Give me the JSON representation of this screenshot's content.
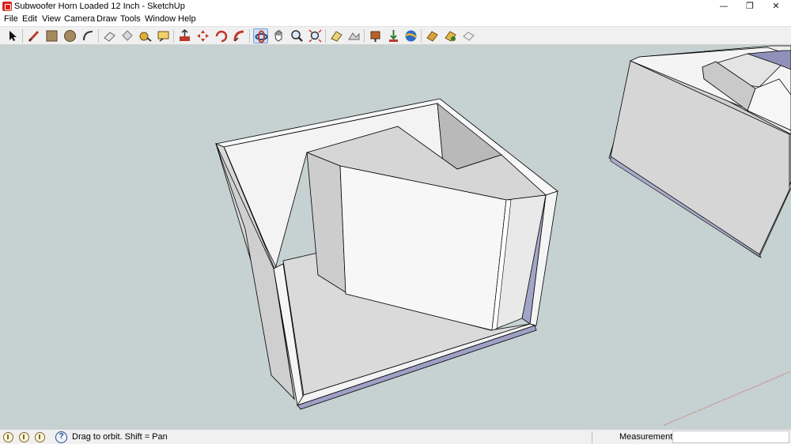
{
  "window": {
    "title": "Subwoofer Horn Loaded 12 Inch - SketchUp",
    "controls": {
      "minimize": "—",
      "restore": "❐",
      "close": "✕"
    }
  },
  "menu": [
    "File",
    "Edit",
    "View",
    "Camera",
    "Draw",
    "Tools",
    "Window",
    "Help"
  ],
  "toolbar": {
    "tools": [
      "select-icon",
      "line-icon",
      "rectangle-icon",
      "circle-icon",
      "arc-icon",
      "eraser-icon",
      "paint-bucket-icon",
      "tape-measure-icon",
      "text-label-icon",
      "push-pull-icon",
      "move-icon",
      "rotate-icon",
      "follow-me-icon",
      "orbit-icon",
      "pan-icon",
      "zoom-icon",
      "zoom-extents-icon",
      "add-location-icon",
      "toggle-terrain-icon",
      "get-models-icon",
      "share-model-icon",
      "extension-warehouse-icon",
      "send-to-layout-icon",
      "extension-manager-icon",
      "photo-textures-icon"
    ]
  },
  "viewport": {
    "background": "#c6d1d1",
    "model": "horn-loaded-subwoofer-enclosure"
  },
  "statusbar": {
    "message": "Drag to orbit.  Shift = Pan",
    "measurements_label": "Measurements",
    "measurements_value": ""
  },
  "colors": {
    "panel_face": "#f4f4f4",
    "panel_shade": "#d9d9d9",
    "back_face": "#9ea0c6",
    "edge": "#000000"
  }
}
